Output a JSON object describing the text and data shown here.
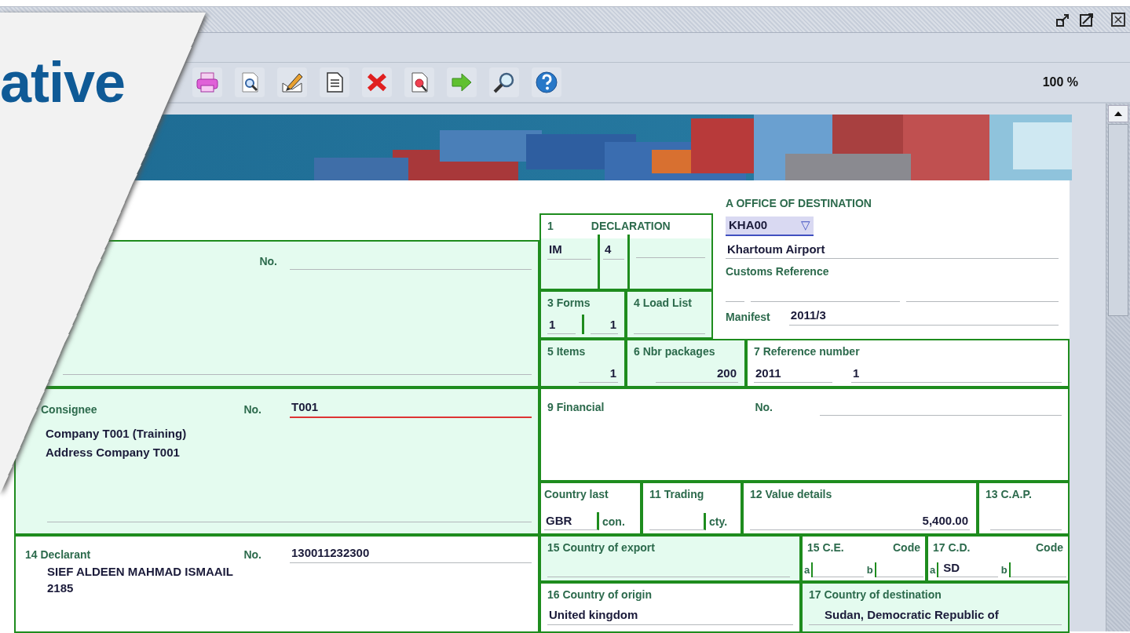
{
  "slide_title": "ative",
  "toolbar": {
    "zoom": "100 %"
  },
  "form": {
    "exporter": {
      "no_label": "No."
    },
    "declaration": {
      "number": "1",
      "label": "DECLARATION",
      "type": "IM",
      "subtype": "4"
    },
    "forms": {
      "label": "3 Forms",
      "value_1": "1",
      "value_2": "1"
    },
    "load_list": {
      "label": "4 Load List"
    },
    "office": {
      "label": "A OFFICE OF DESTINATION",
      "code": "KHA00",
      "dropdown": "▽",
      "name": "Khartoum Airport",
      "customs_reference_label": "Customs Reference",
      "manifest_label": "Manifest",
      "manifest": "2011/3"
    },
    "items": {
      "label": "5 Items",
      "value": "1"
    },
    "packages": {
      "label": "6 Nbr packages",
      "value": "200"
    },
    "reference": {
      "label": "7 Reference number",
      "year": "2011",
      "number": "1"
    },
    "consignee": {
      "label": "Consignee",
      "no_label": "No.",
      "no": "T001",
      "no_invalid": true,
      "lines": [
        "Company T001 (Training)",
        "Address Company T001"
      ]
    },
    "financial": {
      "label": "9 Financial",
      "no_label": "No."
    },
    "country_last": {
      "label": "Country last",
      "value": "GBR",
      "suffix": "con."
    },
    "trading": {
      "label": "11 Trading",
      "suffix": "cty."
    },
    "value_details": {
      "label": "12 Value details",
      "value": "5,400.00"
    },
    "cap": {
      "label": "13 C.A.P."
    },
    "declarant": {
      "label": "14 Declarant",
      "no_label": "No.",
      "no": "130011232300",
      "lines": [
        "SIEF ALDEEN MAHMAD ISMAAIL",
        "2185"
      ]
    },
    "country_export": {
      "label": "15 Country of export"
    },
    "ce": {
      "label": "15 C.E.",
      "code_label": "Code",
      "a": "a",
      "b": "b"
    },
    "cd": {
      "label": "17 C.D.",
      "code_label": "Code",
      "a": "a",
      "a_value": "SD",
      "b": "b"
    },
    "country_origin": {
      "label": "16 Country of origin",
      "value": "United kingdom"
    },
    "country_destination": {
      "label": "17 Country of destination",
      "value": "Sudan, Democratic Republic of"
    }
  }
}
